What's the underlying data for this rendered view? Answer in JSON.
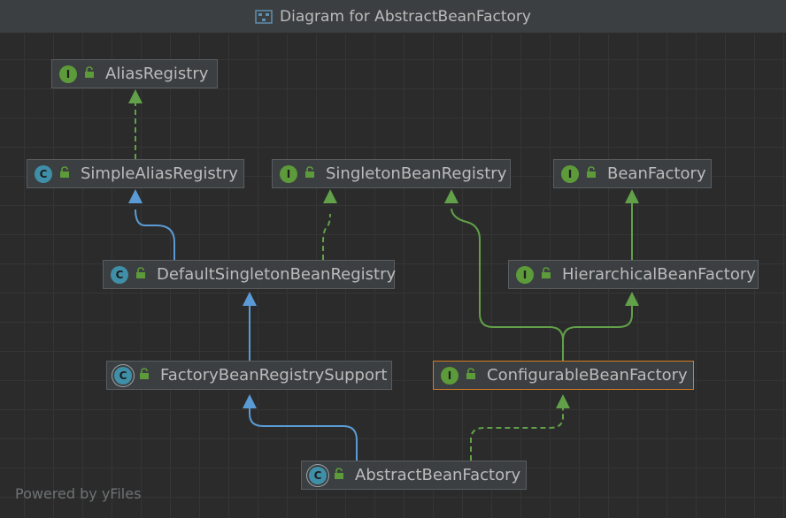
{
  "window": {
    "title": "Diagram for AbstractBeanFactory"
  },
  "footer": {
    "powered_by": "Powered by yFiles"
  },
  "nodes": {
    "alias_registry": {
      "name": "AliasRegistry",
      "kind": "interface",
      "badge": "I"
    },
    "simple_alias_registry": {
      "name": "SimpleAliasRegistry",
      "kind": "class",
      "badge": "C"
    },
    "singleton_bean_registry": {
      "name": "SingletonBeanRegistry",
      "kind": "interface",
      "badge": "I"
    },
    "bean_factory": {
      "name": "BeanFactory",
      "kind": "interface",
      "badge": "I"
    },
    "default_singleton_bean_registry": {
      "name": "DefaultSingletonBeanRegistry",
      "kind": "class",
      "badge": "C"
    },
    "hierarchical_bean_factory": {
      "name": "HierarchicalBeanFactory",
      "kind": "interface",
      "badge": "I"
    },
    "factory_bean_registry_support": {
      "name": "FactoryBeanRegistrySupport",
      "kind": "abstract-class",
      "badge": "C"
    },
    "configurable_bean_factory": {
      "name": "ConfigurableBeanFactory",
      "kind": "interface",
      "badge": "I",
      "selected": true
    },
    "abstract_bean_factory": {
      "name": "AbstractBeanFactory",
      "kind": "abstract-class",
      "badge": "C"
    }
  },
  "edges": [
    {
      "from": "SimpleAliasRegistry",
      "to": "AliasRegistry",
      "relation": "implements"
    },
    {
      "from": "DefaultSingletonBeanRegistry",
      "to": "SimpleAliasRegistry",
      "relation": "extends"
    },
    {
      "from": "DefaultSingletonBeanRegistry",
      "to": "SingletonBeanRegistry",
      "relation": "implements"
    },
    {
      "from": "HierarchicalBeanFactory",
      "to": "BeanFactory",
      "relation": "extends-interface"
    },
    {
      "from": "FactoryBeanRegistrySupport",
      "to": "DefaultSingletonBeanRegistry",
      "relation": "extends"
    },
    {
      "from": "ConfigurableBeanFactory",
      "to": "HierarchicalBeanFactory",
      "relation": "extends-interface"
    },
    {
      "from": "ConfigurableBeanFactory",
      "to": "SingletonBeanRegistry",
      "relation": "extends-interface"
    },
    {
      "from": "AbstractBeanFactory",
      "to": "FactoryBeanRegistrySupport",
      "relation": "extends"
    },
    {
      "from": "AbstractBeanFactory",
      "to": "ConfigurableBeanFactory",
      "relation": "implements"
    }
  ],
  "colors": {
    "class_inheritance": "#5b9bd5",
    "interface_inheritance": "#62a049",
    "selection": "#d67d22",
    "interface_badge": "#5c9a3a",
    "class_badge": "#3f8fa8"
  }
}
